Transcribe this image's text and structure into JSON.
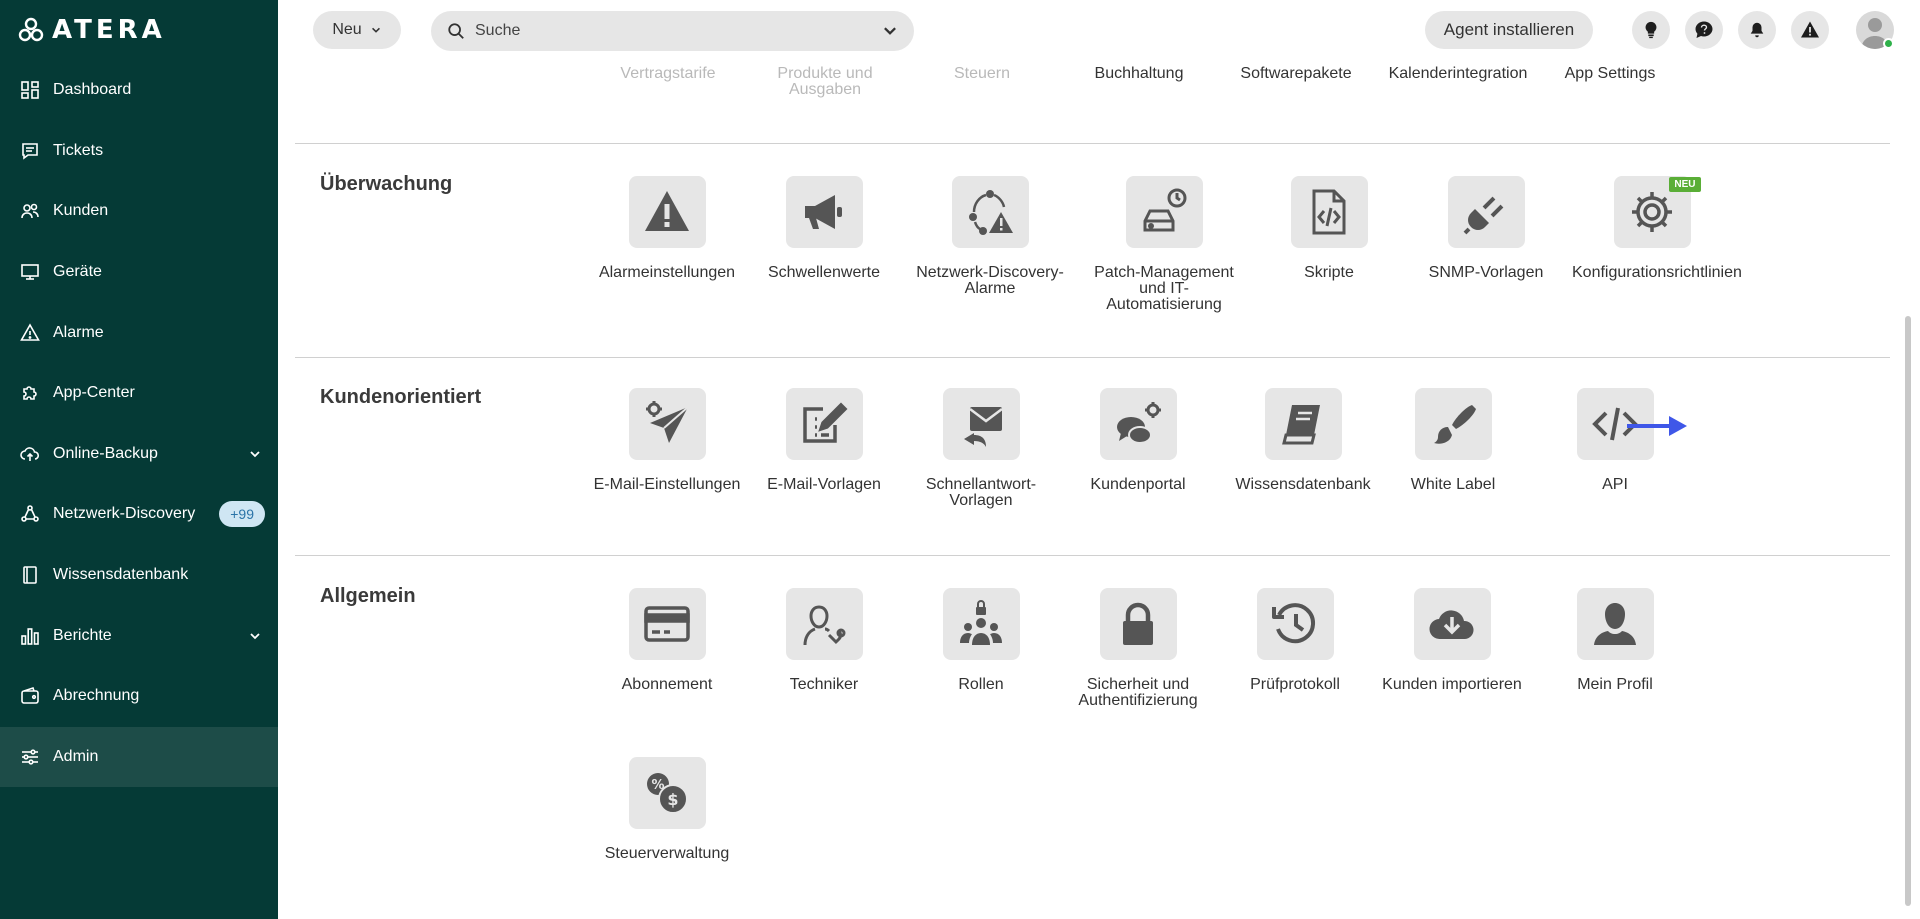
{
  "app": {
    "logo_text": "ATERA"
  },
  "sidebar": {
    "items": [
      {
        "label": "Dashboard",
        "icon": "dashboard-icon"
      },
      {
        "label": "Tickets",
        "icon": "ticket-icon"
      },
      {
        "label": "Kunden",
        "icon": "customers-icon"
      },
      {
        "label": "Geräte",
        "icon": "monitor-icon"
      },
      {
        "label": "Alarme",
        "icon": "alert-icon"
      },
      {
        "label": "App-Center",
        "icon": "puzzle-icon"
      },
      {
        "label": "Online-Backup",
        "icon": "cloud-upload-icon"
      },
      {
        "label": "Netzwerk-Discovery",
        "icon": "network-icon",
        "badge": "+99"
      },
      {
        "label": "Wissensdatenbank",
        "icon": "book-icon"
      },
      {
        "label": "Berichte",
        "icon": "bar-chart-icon"
      },
      {
        "label": "Abrechnung",
        "icon": "wallet-icon"
      },
      {
        "label": "Admin",
        "icon": "sliders-icon",
        "active": true
      }
    ]
  },
  "topbar": {
    "new_label": "Neu",
    "search_placeholder": "Suche",
    "agent_label": "Agent installieren"
  },
  "top_links": [
    {
      "label": "Vertragstarife",
      "faded": true
    },
    {
      "label": "Produkte und Ausgaben",
      "faded": true
    },
    {
      "label": "Steuern",
      "faded": true
    },
    {
      "label": "Buchhaltung",
      "faded": false
    },
    {
      "label": "Softwarepakete",
      "faded": false
    },
    {
      "label": "Kalenderintegration",
      "faded": false
    },
    {
      "label": "App Settings",
      "faded": false
    }
  ],
  "sections": [
    {
      "title": "Überwachung",
      "tiles": [
        {
          "label": "Alarmeinstellungen",
          "icon": "warning-icon"
        },
        {
          "label": "Schwellenwerte",
          "icon": "megaphone-icon"
        },
        {
          "label": "Netzwerk-Discovery-Alarme",
          "icon": "network-alert-icon"
        },
        {
          "label": "Patch-Management und IT-Automatisierung",
          "icon": "patch-clock-icon"
        },
        {
          "label": "Skripte",
          "icon": "script-file-icon"
        },
        {
          "label": "SNMP-Vorlagen",
          "icon": "plug-icon"
        },
        {
          "label": "Konfigurationsrichtlinien",
          "icon": "gear-icon",
          "badge": "NEU"
        }
      ]
    },
    {
      "title": "Kundenorientiert",
      "tiles": [
        {
          "label": "E-Mail-Einstellungen",
          "icon": "send-gear-icon"
        },
        {
          "label": "E-Mail-Vorlagen",
          "icon": "edit-template-icon"
        },
        {
          "label": "Schnellantwort-Vorlagen",
          "icon": "reply-mail-icon"
        },
        {
          "label": "Kundenportal",
          "icon": "chat-gear-icon"
        },
        {
          "label": "Wissensdatenbank",
          "icon": "book-icon"
        },
        {
          "label": "White Label",
          "icon": "brush-icon"
        },
        {
          "label": "API",
          "icon": "code-icon"
        }
      ]
    },
    {
      "title": "Allgemein",
      "tiles": [
        {
          "label": "Abonnement",
          "icon": "credit-card-icon"
        },
        {
          "label": "Techniker",
          "icon": "technician-icon"
        },
        {
          "label": "Rollen",
          "icon": "roles-icon"
        },
        {
          "label": "Sicherheit und Authentifizierung",
          "icon": "lock-icon"
        },
        {
          "label": "Prüfprotokoll",
          "icon": "history-icon"
        },
        {
          "label": "Kunden importieren",
          "icon": "cloud-download-icon"
        },
        {
          "label": "Mein Profil",
          "icon": "user-icon"
        },
        {
          "label": "Steuerverwaltung",
          "icon": "tax-icon"
        }
      ]
    }
  ]
}
